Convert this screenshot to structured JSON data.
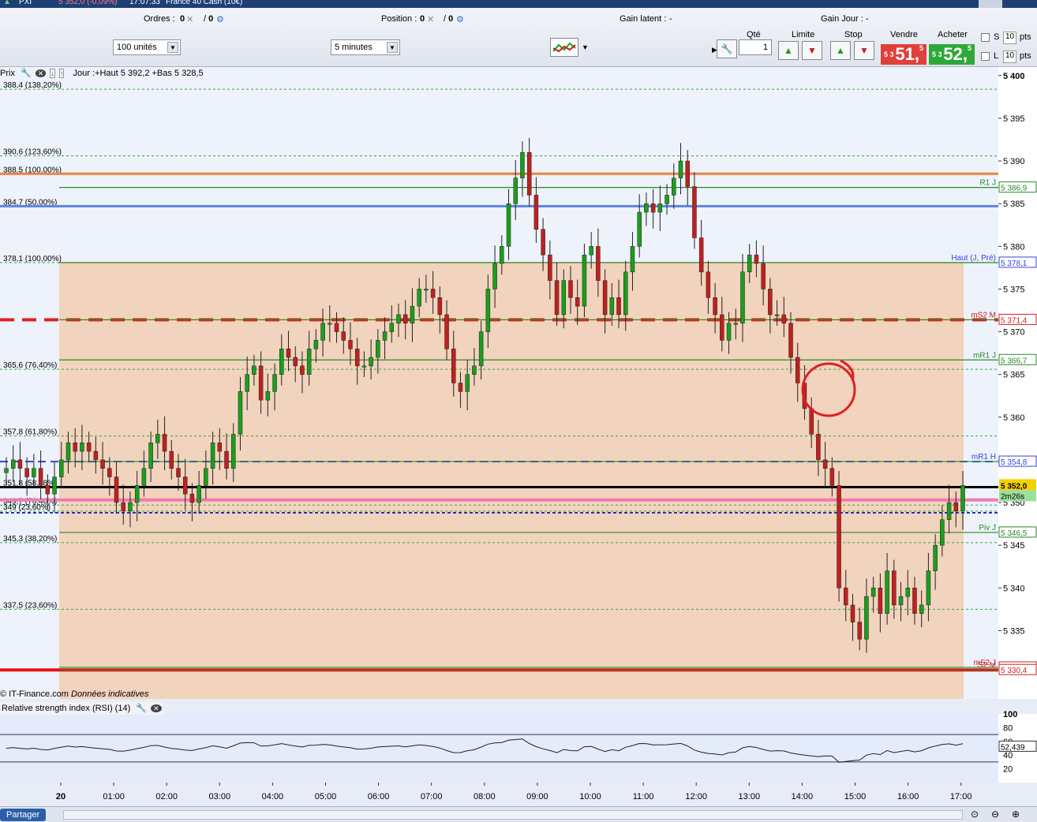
{
  "topbar": {
    "symbol": "PXI",
    "change": "5 352,0 (-0,09%)",
    "time": "17:07:33",
    "instrument": "France 40 Cash (10€)"
  },
  "toolbar": {
    "orders_label": "Ordres :",
    "orders_val": "0",
    "orders_val2": "0",
    "position_label": "Position :",
    "position_val": "0",
    "position_val2": "0",
    "gain_latent_label": "Gain latent :",
    "gain_latent_val": "-",
    "gain_jour_label": "Gain Jour :",
    "gain_jour_val": "-",
    "units": "100 unités",
    "timeframe": "5 minutes",
    "qty_label": "Qté",
    "qty_val": "1",
    "limit_label": "Limite",
    "stop_label": "Stop",
    "sell_label": "Vendre",
    "buy_label": "Acheter",
    "sell_prefix": "5 3",
    "sell_big": "51,",
    "sell_sup": "5",
    "buy_prefix": "5 3",
    "buy_big": "52,",
    "buy_sup": "5",
    "s_label": "S",
    "l_label": "L",
    "s_val": "10",
    "l_val": "10",
    "pts": "pts"
  },
  "price_header": "Prix",
  "price_header_info": "Jour :+Haut 5 392,2 +Bas 5 328,5",
  "credit": "© IT-Finance.com",
  "credit_note": "Données indicatives",
  "rsi_header": "Relative strength index (RSI) (14)",
  "share_label": "Partager",
  "colors": {
    "candle_up": "#1a9e1a",
    "candle_down": "#c02020",
    "band": "#f2d3bd",
    "orange": "#f08040",
    "blue_line": "#5a86e0",
    "red_dash": "#e02020",
    "pink": "#f07ab0",
    "black": "#000000"
  },
  "chart_data": {
    "type": "candlestick",
    "title": "France 40 Cash (10€)",
    "ylim": [
      5327,
      5401
    ],
    "y_ticks": [
      "5 400",
      "5 395",
      "5 390",
      "5 385",
      "5 380",
      "5 375",
      "5 370",
      "5 365",
      "5 360",
      "5 355",
      "5 350",
      "5 345",
      "5 340",
      "5 335"
    ],
    "x_ticks": [
      "20",
      "01:00",
      "02:00",
      "03:00",
      "04:00",
      "05:00",
      "06:00",
      "07:00",
      "08:00",
      "09:00",
      "10:00",
      "11:00",
      "12:00",
      "13:00",
      "14:00",
      "15:00",
      "16:00",
      "17:00"
    ],
    "last_price": "5 352,0",
    "countdown": "2m26s",
    "levels": [
      {
        "label": "388,4 (138,20%)",
        "value": 5398.4
      },
      {
        "label": "390,6 (123,60%)",
        "value": 5390.6
      },
      {
        "label": "388,5 (100,00%)",
        "value": 5388.5
      },
      {
        "label": "384,7 (50,00%)",
        "value": 5384.7
      },
      {
        "label": "378,1 (100,00%)",
        "value": 5378.1
      },
      {
        "label": "365,6 (76,40%)",
        "value": 5365.6
      },
      {
        "label": "357,8 (61,80%)",
        "value": 5357.8
      },
      {
        "label": "351,8 (58,98%)",
        "value": 5351.8
      },
      {
        "label": "349,7 (76,40%)",
        "value": 5349.7
      },
      {
        "label": "349 (23,60%)",
        "value": 5349.0
      },
      {
        "label": "345,3 (38,20%)",
        "value": 5345.3
      },
      {
        "label": "337,5 (23,60%)",
        "value": 5337.5
      }
    ],
    "pivots": [
      {
        "name": "R1 J",
        "value": "5 386,9",
        "v": 5386.9
      },
      {
        "name": "Haut (J, Pré)",
        "value": "5 378,1",
        "v": 5378.1
      },
      {
        "name": "mS2 M",
        "value": "5 371,4",
        "v": 5371.4
      },
      {
        "name": "mR1 J",
        "value": "5 366,7",
        "v": 5366.7
      },
      {
        "name": "mR1 H",
        "value": "5 354,8",
        "v": 5354.8
      },
      {
        "name": "Piv J",
        "value": "5 346,5",
        "v": 5346.5
      },
      {
        "name": "mS2 J",
        "value": "5 330,7",
        "v": 5330.7
      },
      {
        "name": "S2 M",
        "value": "5 330,4",
        "v": 5330.4
      }
    ],
    "closes": [
      5354,
      5355,
      5354,
      5353,
      5354,
      5352,
      5351,
      5353,
      5355,
      5357,
      5356,
      5357,
      5356,
      5355,
      5354,
      5353,
      5350,
      5349,
      5350,
      5352,
      5354,
      5357,
      5358,
      5356,
      5354,
      5353,
      5351,
      5350,
      5352,
      5354,
      5357,
      5356,
      5354,
      5358,
      5363,
      5365,
      5366,
      5362,
      5363,
      5365,
      5368,
      5367,
      5366,
      5365,
      5368,
      5369,
      5371,
      5371,
      5370,
      5369,
      5368,
      5366,
      5366,
      5367,
      5369,
      5370,
      5371,
      5372,
      5371,
      5373,
      5375,
      5375,
      5374,
      5372,
      5368,
      5364,
      5363,
      5365,
      5366,
      5370,
      5375,
      5378,
      5380,
      5385,
      5388,
      5391,
      5386,
      5382,
      5379,
      5376,
      5372,
      5376,
      5374,
      5373,
      5379,
      5380,
      5376,
      5372,
      5374,
      5372,
      5377,
      5380,
      5384,
      5385,
      5384,
      5385,
      5386,
      5388,
      5390,
      5387,
      5381,
      5377,
      5374,
      5372,
      5369,
      5371,
      5371,
      5377,
      5379,
      5378,
      5375,
      5372,
      5372,
      5371,
      5367,
      5364,
      5361,
      5358,
      5355,
      5354,
      5352,
      5340,
      5338,
      5336,
      5334,
      5339,
      5340,
      5337,
      5342,
      5338,
      5339,
      5340,
      5337,
      5338,
      5342,
      5345,
      5348,
      5350,
      5349,
      5352
    ],
    "rsi": {
      "ylim": [
        0,
        100
      ],
      "ticks": [
        "100",
        "80",
        "60",
        "40",
        "20"
      ],
      "last": "52,439",
      "levels": [
        70,
        30
      ]
    }
  }
}
